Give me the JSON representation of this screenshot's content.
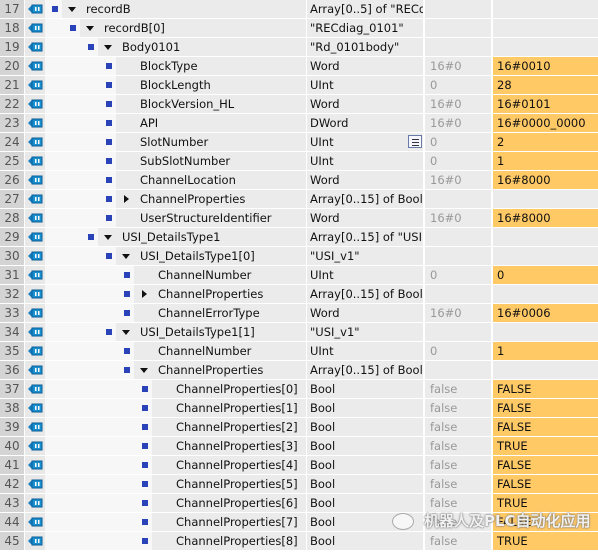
{
  "colors": {
    "monitor_value_bg": "#ffc966",
    "marker": "#2a43b8"
  },
  "rows": [
    {
      "num": "17",
      "level": 0,
      "expand": "open",
      "name": "recordB",
      "type": "Array[0..5] of \"RECd...",
      "start": "",
      "monitor": ""
    },
    {
      "num": "18",
      "level": 1,
      "expand": "open",
      "name": "recordB[0]",
      "type": "\"RECdiag_0101\"",
      "start": "",
      "monitor": ""
    },
    {
      "num": "19",
      "level": 2,
      "expand": "open",
      "name": "Body0101",
      "type": "\"Rd_0101body\"",
      "start": "",
      "monitor": ""
    },
    {
      "num": "20",
      "level": 3,
      "expand": null,
      "name": "BlockType",
      "type": "Word",
      "start": "16#0",
      "monitor": "16#0010"
    },
    {
      "num": "21",
      "level": 3,
      "expand": null,
      "name": "BlockLength",
      "type": "UInt",
      "start": "0",
      "monitor": "28"
    },
    {
      "num": "22",
      "level": 3,
      "expand": null,
      "name": "BlockVersion_HL",
      "type": "Word",
      "start": "16#0",
      "monitor": "16#0101"
    },
    {
      "num": "23",
      "level": 3,
      "expand": null,
      "name": "API",
      "type": "DWord",
      "start": "16#0",
      "monitor": "16#0000_0000"
    },
    {
      "num": "24",
      "level": 3,
      "expand": null,
      "name": "SlotNumber",
      "type": "UInt",
      "start": "0",
      "monitor": "2",
      "list_button": true
    },
    {
      "num": "25",
      "level": 3,
      "expand": null,
      "name": "SubSlotNumber",
      "type": "UInt",
      "start": "0",
      "monitor": "1"
    },
    {
      "num": "26",
      "level": 3,
      "expand": null,
      "name": "ChannelLocation",
      "type": "Word",
      "start": "16#0",
      "monitor": "16#8000"
    },
    {
      "num": "27",
      "level": 3,
      "expand": "closed",
      "name": "ChannelProperties",
      "type": "Array[0..15] of Bool",
      "start": "",
      "monitor": ""
    },
    {
      "num": "28",
      "level": 3,
      "expand": null,
      "name": "UserStructureIdentifier",
      "type": "Word",
      "start": "16#0",
      "monitor": "16#8000"
    },
    {
      "num": "29",
      "level": 2,
      "expand": "open",
      "name": "USI_DetailsType1",
      "type": "Array[0..15] of \"USI...",
      "start": "",
      "monitor": ""
    },
    {
      "num": "30",
      "level": 3,
      "expand": "open",
      "name": "USI_DetailsType1[0]",
      "type": "\"USI_v1\"",
      "start": "",
      "monitor": ""
    },
    {
      "num": "31",
      "level": 4,
      "expand": null,
      "name": "ChannelNumber",
      "type": "UInt",
      "start": "0",
      "monitor": "0"
    },
    {
      "num": "32",
      "level": 4,
      "expand": "closed",
      "name": "ChannelProperties",
      "type": "Array[0..15] of Bool",
      "start": "",
      "monitor": ""
    },
    {
      "num": "33",
      "level": 4,
      "expand": null,
      "name": "ChannelErrorType",
      "type": "Word",
      "start": "16#0",
      "monitor": "16#0006"
    },
    {
      "num": "34",
      "level": 3,
      "expand": "open",
      "name": "USI_DetailsType1[1]",
      "type": "\"USI_v1\"",
      "start": "",
      "monitor": ""
    },
    {
      "num": "35",
      "level": 4,
      "expand": null,
      "name": "ChannelNumber",
      "type": "UInt",
      "start": "0",
      "monitor": "1"
    },
    {
      "num": "36",
      "level": 4,
      "expand": "open",
      "name": "ChannelProperties",
      "type": "Array[0..15] of Bool",
      "start": "",
      "monitor": ""
    },
    {
      "num": "37",
      "level": 5,
      "expand": null,
      "name": "ChannelProperties[0]",
      "type": "Bool",
      "start": "false",
      "monitor": "FALSE"
    },
    {
      "num": "38",
      "level": 5,
      "expand": null,
      "name": "ChannelProperties[1]",
      "type": "Bool",
      "start": "false",
      "monitor": "FALSE"
    },
    {
      "num": "39",
      "level": 5,
      "expand": null,
      "name": "ChannelProperties[2]",
      "type": "Bool",
      "start": "false",
      "monitor": "FALSE"
    },
    {
      "num": "40",
      "level": 5,
      "expand": null,
      "name": "ChannelProperties[3]",
      "type": "Bool",
      "start": "false",
      "monitor": "TRUE"
    },
    {
      "num": "41",
      "level": 5,
      "expand": null,
      "name": "ChannelProperties[4]",
      "type": "Bool",
      "start": "false",
      "monitor": "FALSE"
    },
    {
      "num": "42",
      "level": 5,
      "expand": null,
      "name": "ChannelProperties[5]",
      "type": "Bool",
      "start": "false",
      "monitor": "FALSE"
    },
    {
      "num": "43",
      "level": 5,
      "expand": null,
      "name": "ChannelProperties[6]",
      "type": "Bool",
      "start": "false",
      "monitor": "TRUE"
    },
    {
      "num": "44",
      "level": 5,
      "expand": null,
      "name": "ChannelProperties[7]",
      "type": "Bool",
      "start": "false",
      "monitor": "FALSE"
    },
    {
      "num": "45",
      "level": 5,
      "expand": null,
      "name": "ChannelProperties[8]",
      "type": "Bool",
      "start": "false",
      "monitor": "TRUE"
    }
  ],
  "watermark": "机器人及PLC自动化应用"
}
